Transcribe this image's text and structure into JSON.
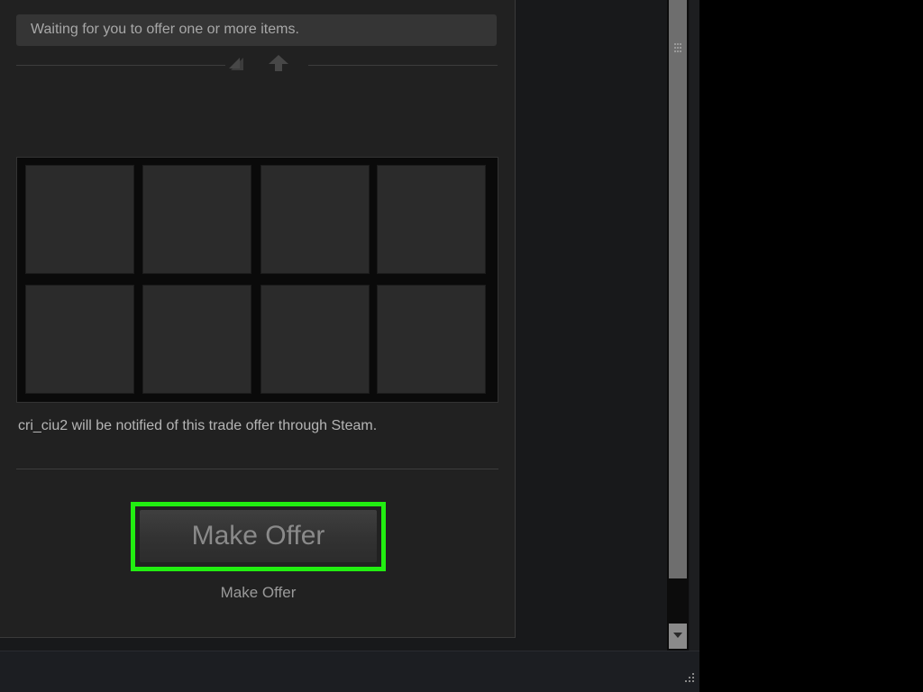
{
  "trade": {
    "status_message": "Waiting for you to offer one or more items.",
    "notice": "cri_ciu2 will be notified of this trade offer through Steam.",
    "item_slots": [
      "",
      "",
      "",
      "",
      "",
      "",
      "",
      ""
    ]
  },
  "actions": {
    "make_offer_label": "Make Offer",
    "make_offer_caption": "Make Offer"
  },
  "icons": {
    "swap": "swap-arrows-icon",
    "up": "up-arrow-icon",
    "scroll_down": "chevron-down-icon",
    "resize": "resize-grip-icon"
  },
  "colors": {
    "highlight": "#22ee11",
    "panel_bg": "#212121",
    "window_bg": "#000000"
  }
}
